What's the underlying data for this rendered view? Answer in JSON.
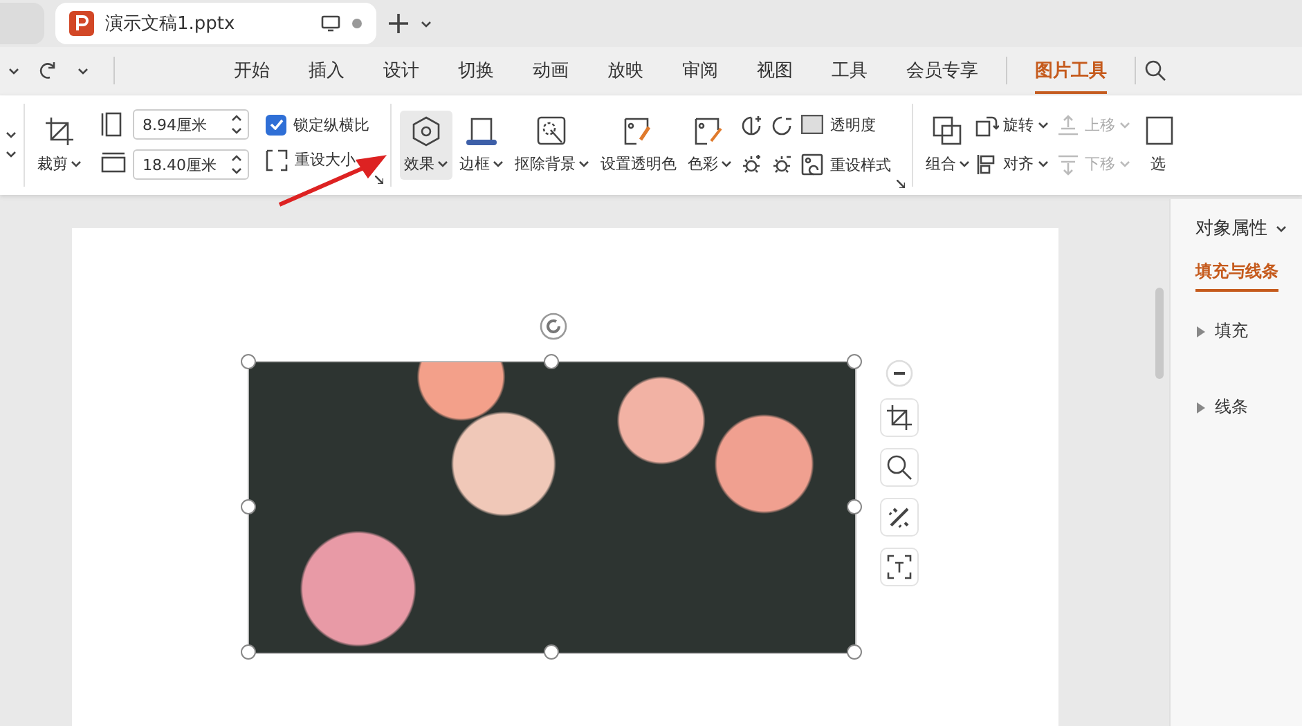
{
  "tabs": [
    {
      "title": "演示文稿1.pptx",
      "selected": true
    }
  ],
  "menu": [
    {
      "label": "开始",
      "selected": false
    },
    {
      "label": "插入",
      "selected": false
    },
    {
      "label": "设计",
      "selected": false
    },
    {
      "label": "切换",
      "selected": false
    },
    {
      "label": "动画",
      "selected": false
    },
    {
      "label": "放映",
      "selected": false
    },
    {
      "label": "审阅",
      "selected": false
    },
    {
      "label": "视图",
      "selected": false
    },
    {
      "label": "工具",
      "selected": false
    },
    {
      "label": "会员专享",
      "selected": false
    },
    {
      "label": "图片工具",
      "selected": true
    }
  ],
  "ribbon": {
    "crop": {
      "label": "裁剪"
    },
    "height": {
      "value": "8.94厘米"
    },
    "width": {
      "value": "18.40厘米"
    },
    "lock_ratio": {
      "label": "锁定纵横比",
      "checked": true
    },
    "reset_size": {
      "label": "重设大小"
    },
    "buttons": [
      {
        "kind": "effect",
        "label": "效果",
        "dropdown": true,
        "highlighted": true
      },
      {
        "kind": "border",
        "label": "边框",
        "dropdown": true,
        "highlighted": false
      },
      {
        "kind": "remove-bg",
        "label": "抠除背景",
        "dropdown": true,
        "highlighted": false
      },
      {
        "kind": "transparent",
        "label": "设置透明色",
        "dropdown": false,
        "highlighted": false
      },
      {
        "kind": "color",
        "label": "色彩",
        "dropdown": true,
        "highlighted": false
      }
    ],
    "transparency": {
      "label": "透明度"
    },
    "reset_style": {
      "label": "重设样式"
    },
    "group": {
      "label": "组合"
    },
    "arrange": [
      {
        "kind": "rotate",
        "label": "旋转",
        "disabled": false
      },
      {
        "kind": "align",
        "label": "对齐",
        "disabled": false
      },
      {
        "kind": "up",
        "label": "上移",
        "disabled": true
      },
      {
        "kind": "down",
        "label": "下移",
        "disabled": true
      }
    ],
    "select": {
      "label": "选"
    }
  },
  "panel": {
    "title": "对象属性",
    "tabs": [
      {
        "label": "填充与线条",
        "selected": true
      }
    ],
    "sections": [
      {
        "label": "填充",
        "expanded": false
      },
      {
        "label": "线条",
        "expanded": false
      }
    ]
  }
}
